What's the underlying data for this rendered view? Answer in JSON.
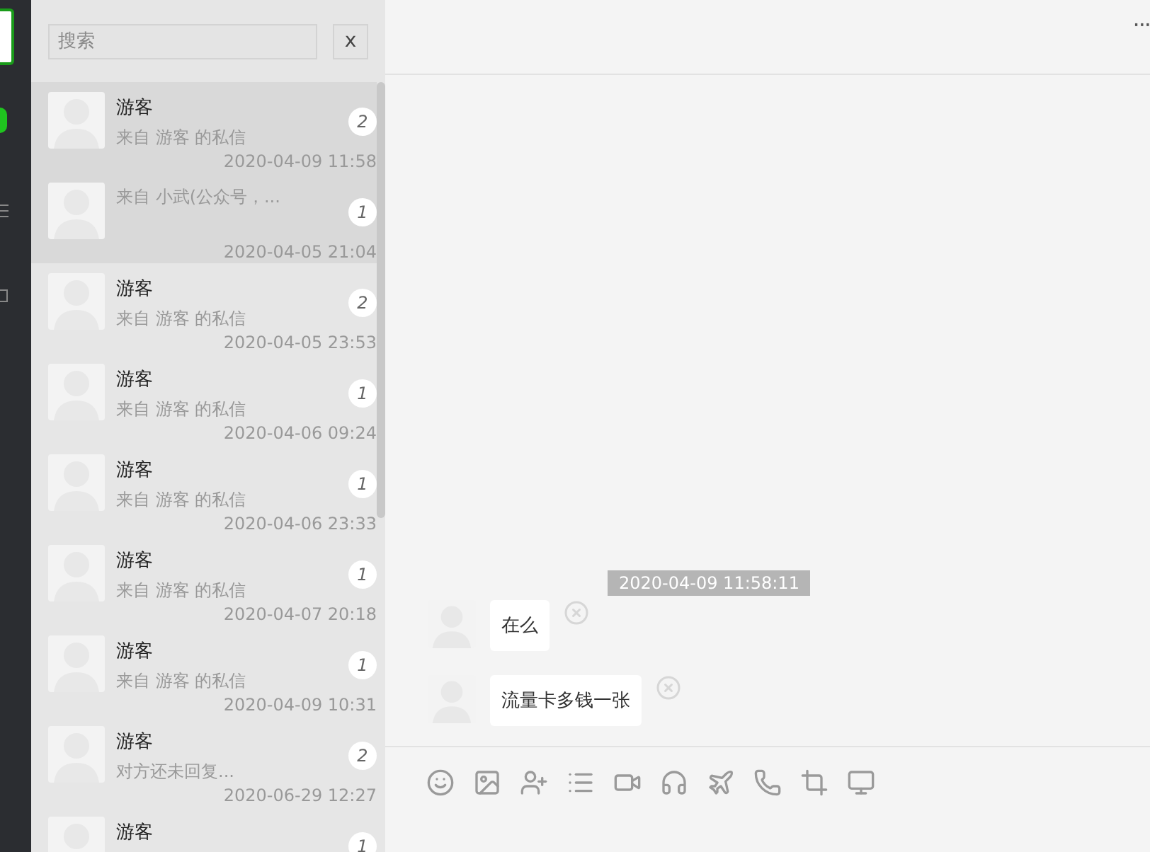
{
  "search": {
    "placeholder": "搜索",
    "clear": "x"
  },
  "conversations": [
    {
      "name": "游客",
      "preview": "来自 游客 的私信",
      "count": "2",
      "time": "2020-04-09 11:58",
      "selected": true
    },
    {
      "preview": "来自 小武(公众号，...",
      "count": "1",
      "time": "2020-04-05 21:04",
      "selected": true
    },
    {
      "name": "游客",
      "preview": "来自 游客 的私信",
      "count": "2",
      "time": "2020-04-05 23:53",
      "selected": false
    },
    {
      "name": "游客",
      "preview": "来自 游客 的私信",
      "count": "1",
      "time": "2020-04-06 09:24",
      "selected": false
    },
    {
      "name": "游客",
      "preview": "来自 游客 的私信",
      "count": "1",
      "time": "2020-04-06 23:33",
      "selected": false
    },
    {
      "name": "游客",
      "preview": "来自 游客 的私信",
      "count": "1",
      "time": "2020-04-07 20:18",
      "selected": false
    },
    {
      "name": "游客",
      "preview": "来自 游客 的私信",
      "count": "1",
      "time": "2020-04-09 10:31",
      "selected": false
    },
    {
      "name": "游客",
      "preview": "对方还未回复...",
      "count": "2",
      "time": "2020-06-29 12:27",
      "selected": false
    },
    {
      "name": "游客",
      "count": "1",
      "selected": false
    }
  ],
  "chat": {
    "more": "···",
    "timestamp": "2020-04-09 11:58:11",
    "messages": [
      {
        "text": "在么"
      },
      {
        "text": "流量卡多钱一张"
      }
    ],
    "toolbar": [
      {
        "kind": "emoji"
      },
      {
        "kind": "image"
      },
      {
        "kind": "add-user"
      },
      {
        "kind": "list"
      },
      {
        "kind": "video"
      },
      {
        "kind": "headphones"
      },
      {
        "kind": "plane"
      },
      {
        "kind": "phone"
      },
      {
        "kind": "crop"
      },
      {
        "kind": "monitor"
      }
    ]
  }
}
